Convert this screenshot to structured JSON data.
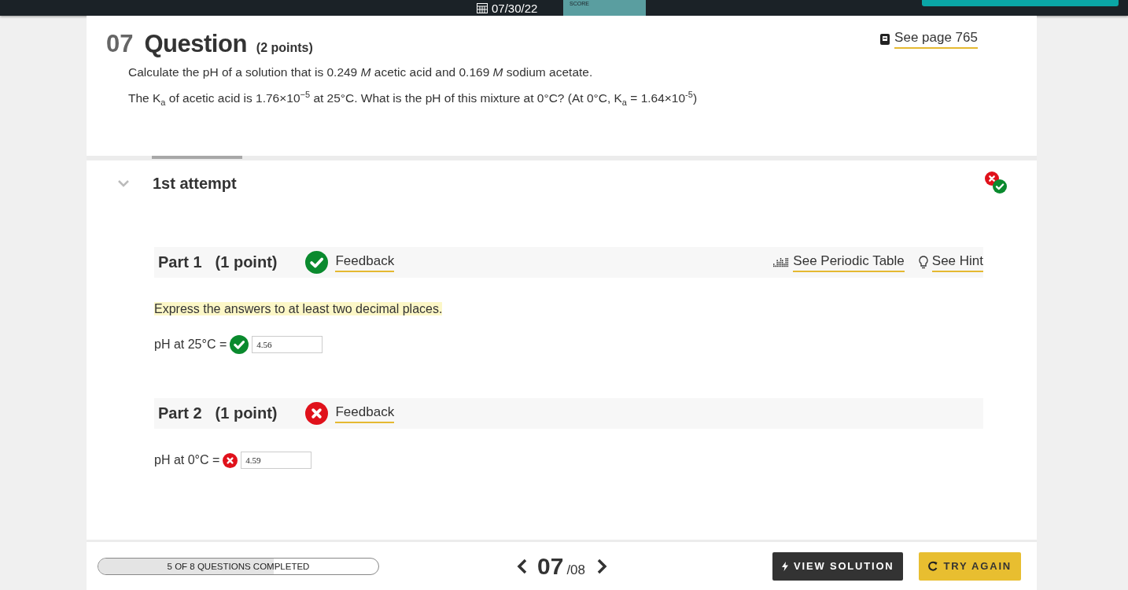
{
  "top_bar": {
    "date": "07/30/22",
    "score_label": "SCORE"
  },
  "question": {
    "number": "07",
    "title": "Question",
    "points": "(2 points)",
    "lines": [
      "Calculate the pH of a solution that is 0.249 *M* acetic acid and 0.169 *M* sodium acetate.",
      "The K$_{a}$ of acetic acid is 1.76×10$^{−5}$ at 25°C.  What is the pH of this mixture at 0°C? (At 0°C, K$_{a}$ = 1.64×10$^{-5}$)"
    ],
    "reference_link": "See page 765"
  },
  "attempt": {
    "title": "1st attempt",
    "expanded": true,
    "results": [
      {
        "correct": false
      },
      {
        "correct": true
      }
    ]
  },
  "parts": [
    {
      "title": "Part 1",
      "points": "(1 point)",
      "correct": true,
      "feedback": "Feedback",
      "tools": [
        {
          "kind": "periodic",
          "label": "See Periodic Table"
        },
        {
          "kind": "hint",
          "label": "See Hint"
        }
      ],
      "instruction": "Express the answers to at least two decimal places.",
      "answers": [
        {
          "label": "pH at 25°C =",
          "correct": true,
          "value": "4.56"
        }
      ]
    },
    {
      "title": "Part 2",
      "points": "(1 point)",
      "correct": false,
      "feedback": "Feedback",
      "answers": [
        {
          "label": "pH at 0°C =",
          "correct": false,
          "value": "4.59"
        }
      ]
    }
  ],
  "footer": {
    "progress": {
      "label": "5 OF 8 QUESTIONS COMPLETED",
      "level": 0.625
    },
    "current": "07",
    "total": "/08",
    "buttons": [
      {
        "kind": "solution",
        "label": "VIEW SOLUTION"
      },
      {
        "kind": "retry",
        "label": "TRY AGAIN"
      }
    ]
  }
}
